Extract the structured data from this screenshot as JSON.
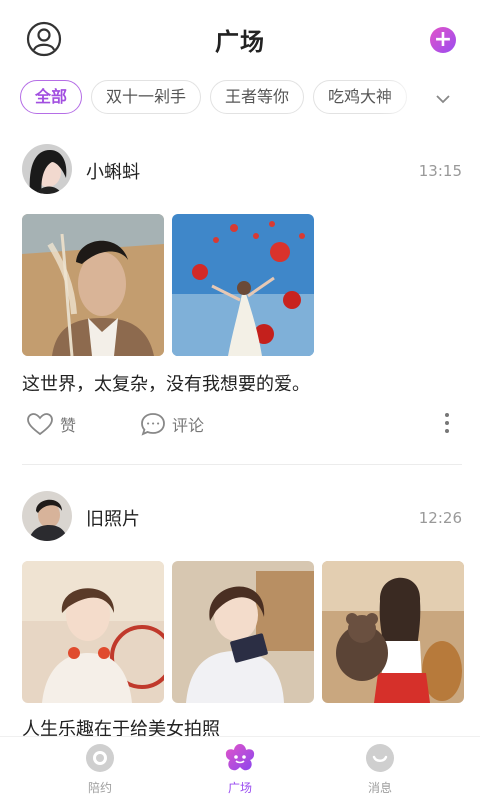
{
  "header": {
    "title": "广场"
  },
  "tabs": [
    "全部",
    "双十一剁手",
    "王者等你",
    "吃鸡大神"
  ],
  "posts": [
    {
      "user": "小蝌蚪",
      "time": "13:15",
      "caption": "这世界，太复杂，没有我想要的爱。",
      "like_label": "赞",
      "comment_label": "评论",
      "photos": 2
    },
    {
      "user": "旧照片",
      "time": "12:26",
      "caption": "人生乐趣在于给美女拍照",
      "photos": 3
    }
  ],
  "bottom_nav": [
    "陪约",
    "广场",
    "消息"
  ],
  "colors": {
    "accent": "#9a4cf0",
    "accent_pink": "#e254c8"
  }
}
